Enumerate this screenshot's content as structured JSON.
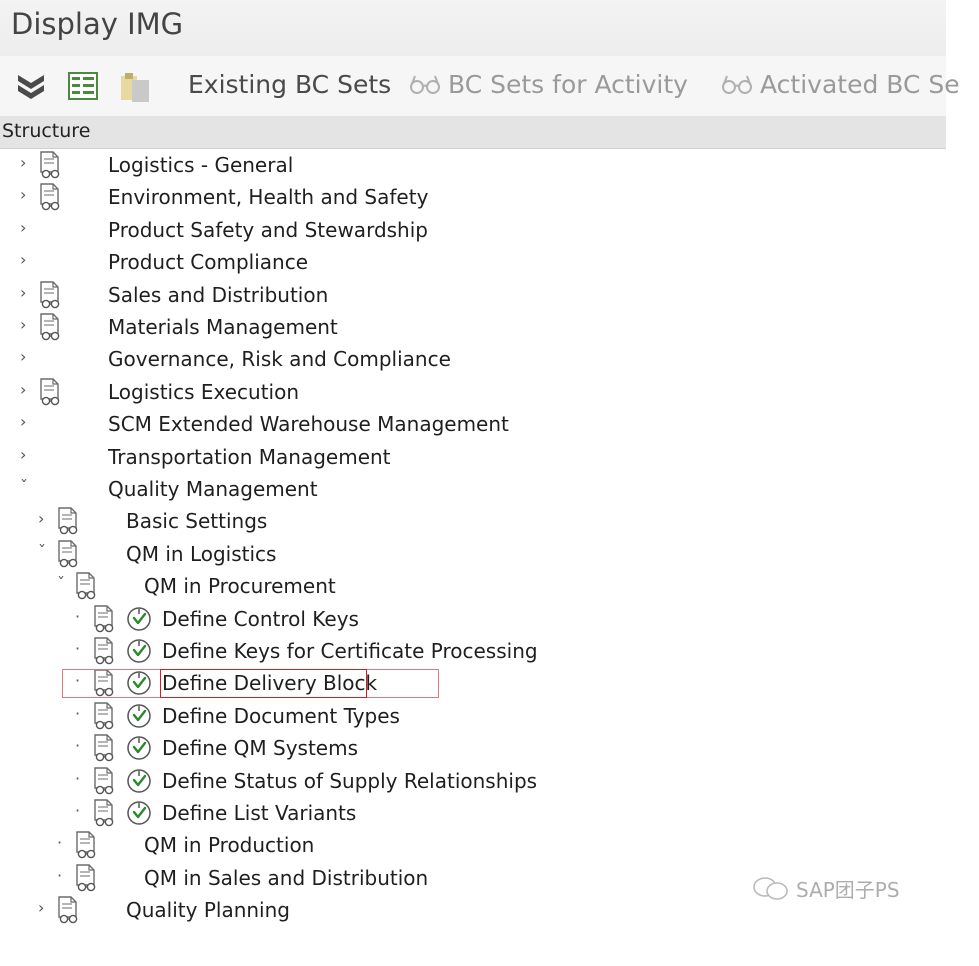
{
  "window": {
    "title": "Display IMG"
  },
  "toolbar": {
    "existing_bc_sets": "Existing BC Sets",
    "bc_sets_for_activity": "BC Sets for Activity",
    "activated_bc_sets": "Activated BC Se"
  },
  "tree": {
    "header": "Structure",
    "items": [
      {
        "label": "Logistics - General",
        "level": 0,
        "expander": "›",
        "icon": "doc-glasses-icon"
      },
      {
        "label": "Environment, Health and Safety",
        "level": 0,
        "expander": "›",
        "icon": "doc-glasses-icon"
      },
      {
        "label": "Product Safety and Stewardship",
        "level": 0,
        "expander": "›",
        "icon": ""
      },
      {
        "label": "Product Compliance",
        "level": 0,
        "expander": "›",
        "icon": ""
      },
      {
        "label": "Sales and Distribution",
        "level": 0,
        "expander": "›",
        "icon": "doc-glasses-icon"
      },
      {
        "label": "Materials Management",
        "level": 0,
        "expander": "›",
        "icon": "doc-glasses-icon"
      },
      {
        "label": "Governance, Risk and Compliance",
        "level": 0,
        "expander": "›",
        "icon": ""
      },
      {
        "label": "Logistics Execution",
        "level": 0,
        "expander": "›",
        "icon": "doc-glasses-icon"
      },
      {
        "label": "SCM Extended Warehouse Management",
        "level": 0,
        "expander": "›",
        "icon": ""
      },
      {
        "label": "Transportation Management",
        "level": 0,
        "expander": "›",
        "icon": ""
      },
      {
        "label": "Quality Management",
        "level": 0,
        "expander": "ˇ",
        "icon": ""
      },
      {
        "label": "Basic Settings",
        "level": 1,
        "expander": "›",
        "icon": "doc-glasses-icon"
      },
      {
        "label": "QM in Logistics",
        "level": 1,
        "expander": "ˇ",
        "icon": "doc-glasses-icon"
      },
      {
        "label": "QM in Procurement",
        "level": 2,
        "expander": "ˇ",
        "icon": "doc-glasses-icon"
      },
      {
        "label": "Define Control Keys",
        "level": 3,
        "expander": "·",
        "icon": "doc-glasses-icon",
        "activity": "execute-clock-icon"
      },
      {
        "label": "Define Keys for Certificate Processing",
        "level": 3,
        "expander": "·",
        "icon": "doc-glasses-icon",
        "activity": "execute-clock-icon"
      },
      {
        "label": "Define Delivery Block",
        "level": 3,
        "expander": "·",
        "icon": "doc-glasses-icon",
        "activity": "execute-clock-icon",
        "selected": true
      },
      {
        "label": "Define Document Types",
        "level": 3,
        "expander": "·",
        "icon": "doc-glasses-icon",
        "activity": "execute-clock-icon"
      },
      {
        "label": "Define QM Systems",
        "level": 3,
        "expander": "·",
        "icon": "doc-glasses-icon",
        "activity": "execute-clock-icon"
      },
      {
        "label": "Define Status of Supply Relationships",
        "level": 3,
        "expander": "·",
        "icon": "doc-glasses-icon",
        "activity": "execute-clock-icon"
      },
      {
        "label": "Define List Variants",
        "level": 3,
        "expander": "·",
        "icon": "doc-glasses-icon",
        "activity": "execute-clock-icon"
      },
      {
        "label": "QM in Production",
        "level": 2,
        "expander": "·",
        "icon": "doc-glasses-icon"
      },
      {
        "label": "QM in Sales and Distribution",
        "level": 2,
        "expander": "·",
        "icon": "doc-glasses-icon"
      },
      {
        "label": "Quality Planning",
        "level": 1,
        "expander": "›",
        "icon": "doc-glasses-icon"
      }
    ]
  },
  "watermark": {
    "text": "SAP团子PS"
  },
  "colors": {
    "activity_green": "#2a8a2a",
    "selection_border": "#d02020",
    "toolbar_text": "#4a4a4a"
  }
}
